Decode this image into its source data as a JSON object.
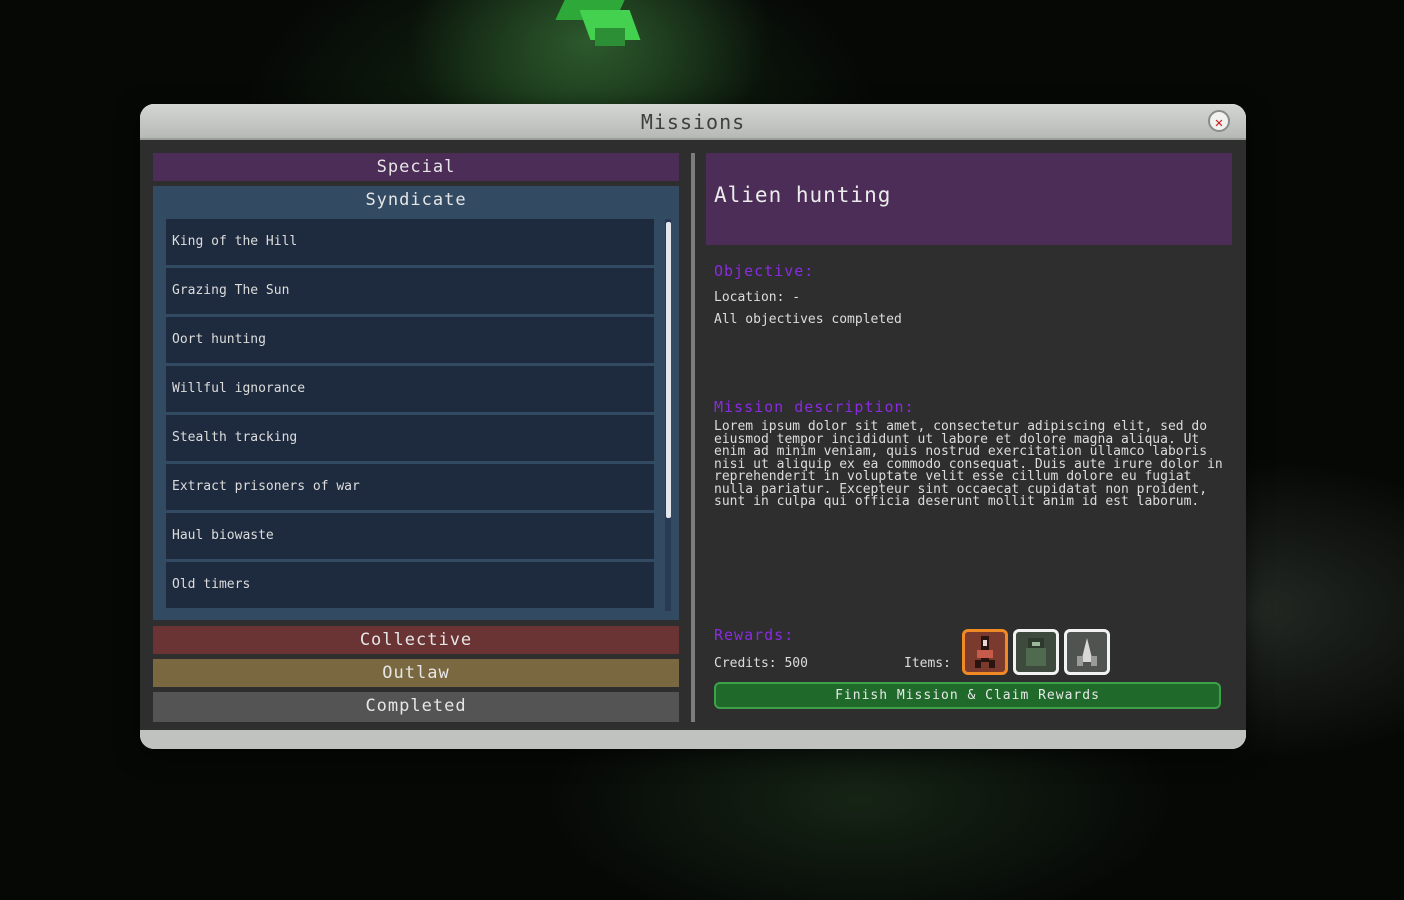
{
  "window": {
    "title": "Missions",
    "close_icon": "✕"
  },
  "categories": {
    "special": "Special",
    "syndicate": "Syndicate",
    "collective": "Collective",
    "outlaw": "Outlaw",
    "completed": "Completed"
  },
  "missions": [
    "King of the Hill",
    "Grazing The Sun",
    "Oort hunting",
    "Willful ignorance",
    "Stealth tracking",
    "Extract prisoners of war",
    "Haul biowaste",
    "Old timers"
  ],
  "detail": {
    "title": "Alien hunting",
    "objective_label": "Objective:",
    "location": "Location: -",
    "objective_status": "All objectives completed",
    "description_label": "Mission description:",
    "description": "Lorem ipsum dolor sit amet, consectetur adipiscing elit, sed do eiusmod tempor incididunt ut labore et dolore magna aliqua. Ut enim ad minim veniam, quis nostrud exercitation ullamco laboris nisi ut aliquip ex ea commodo consequat. Duis aute irure dolor in reprehenderit in voluptate velit esse cillum dolore eu fugiat nulla pariatur. Excepteur sint occaecat cupidatat non proident, sunt in culpa qui officia deserunt mollit anim id est laborum.",
    "rewards_label": "Rewards:",
    "credits": "Credits: 500",
    "items_label": "Items:",
    "reward_items": [
      "rocket-item-icon",
      "armor-item-icon",
      "ship-item-icon"
    ],
    "finish_button": "Finish Mission & Claim Rewards"
  },
  "colors": {
    "special": "#4b2d57",
    "syndicate": "#334a63",
    "collective": "#6a3434",
    "outlaw": "#7a6840",
    "completed": "#545454",
    "section_label": "#8a2be2",
    "finish_button": "#1f6a2a"
  }
}
